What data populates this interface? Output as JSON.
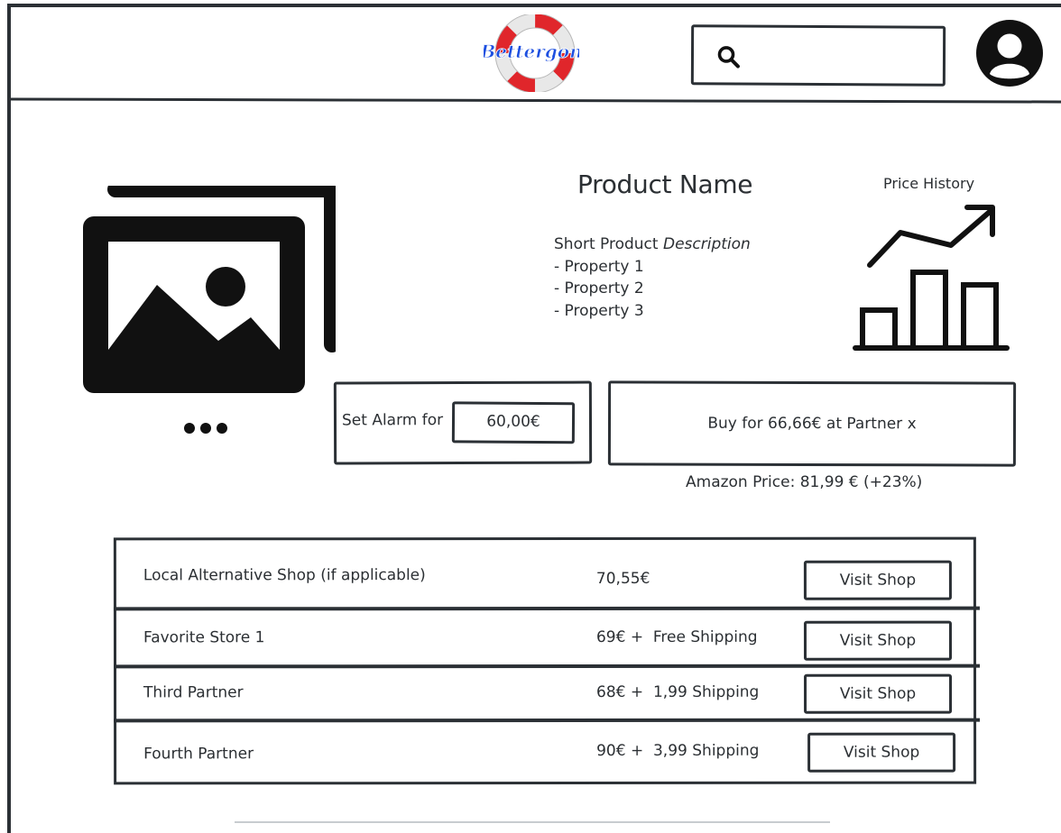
{
  "header": {
    "logo_text": "Bettergon",
    "search": {
      "value": "",
      "placeholder": ""
    }
  },
  "product": {
    "name": "Product Name",
    "description_prefix": "Short Product ",
    "description_emphasis": "Description",
    "properties": [
      "- Property 1",
      "- Property 2",
      "- Property 3"
    ],
    "price_history_label": "Price History"
  },
  "alarm": {
    "label": "Set Alarm for",
    "value": "60,00€"
  },
  "buy": {
    "label": "Buy for 66,66€ at Partner x"
  },
  "amazon_price": "Amazon Price: 81,99 € (+23%)",
  "shops": [
    {
      "name": "Local Alternative Shop (if applicable)",
      "price": "70,55€",
      "button": "Visit Shop"
    },
    {
      "name": "Favorite Store 1",
      "price": "69€ +  Free Shipping",
      "button": "Visit Shop"
    },
    {
      "name": "Third Partner",
      "price": "68€ +  1,99 Shipping",
      "button": "Visit Shop"
    },
    {
      "name": "Fourth Partner",
      "price": "90€ +  3,99 Shipping",
      "button": "Visit Shop"
    }
  ],
  "icons": {
    "logo": "lifebuoy-logo-icon",
    "search": "search-icon",
    "avatar": "user-avatar-icon",
    "gallery": "image-gallery-icon",
    "more": "more-dots-icon",
    "price_history": "price-history-chart-icon"
  },
  "colors": {
    "ink": "#2b3035",
    "logo_red": "#e0262b",
    "logo_blue": "#1d4fe0"
  }
}
